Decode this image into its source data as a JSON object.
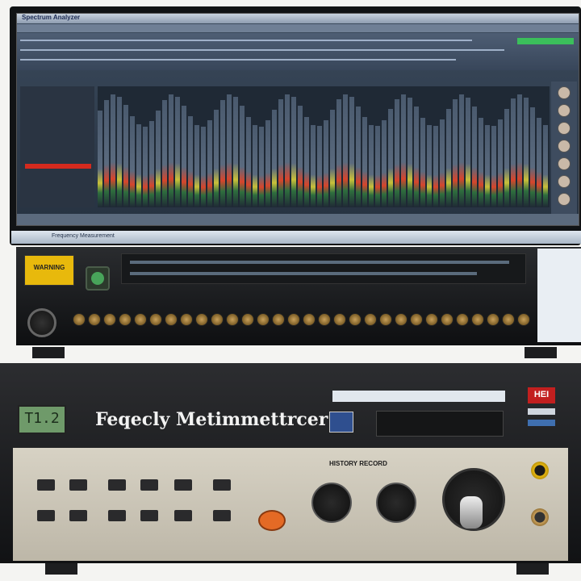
{
  "monitor": {
    "window_title": "Spectrum Analyzer",
    "taskbar_text": "Frequency Measurement"
  },
  "rack": {
    "warning_label": "WARNING"
  },
  "device": {
    "lcd_value": "T1.2",
    "title": "Feqecly Metimmettrcer",
    "badge": "HEI",
    "panel_title": "HISTORY RECORD"
  },
  "colors": {
    "accent": "#c21f1f",
    "screen_bg": "#263241",
    "lcd_green": "#6f9a6a",
    "orange_button": "#e46a25"
  }
}
